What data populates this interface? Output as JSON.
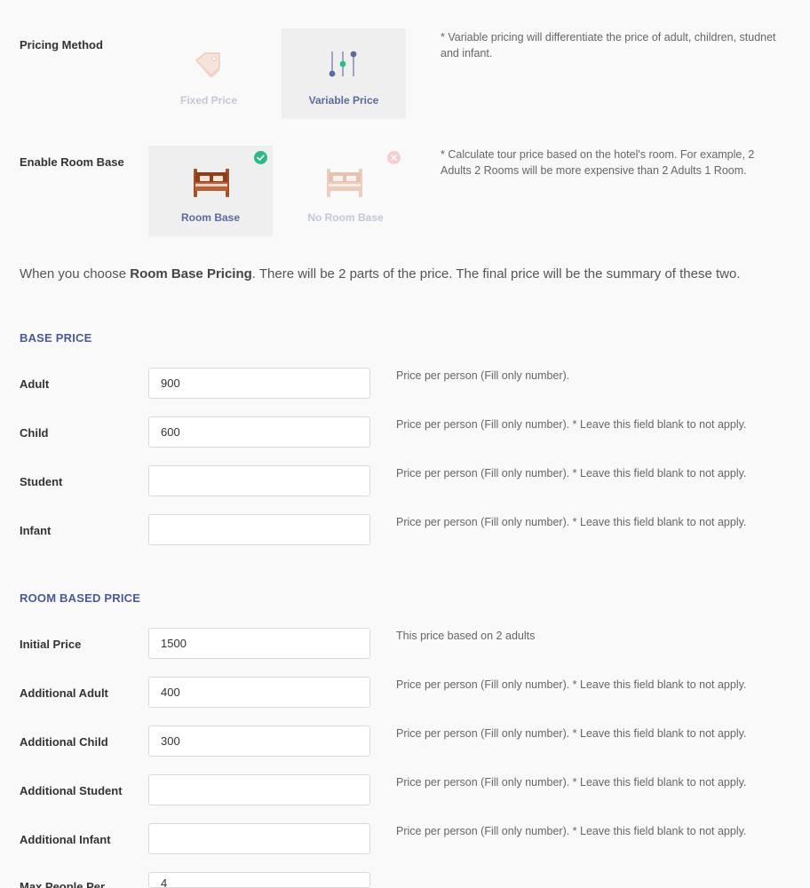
{
  "pricing_method": {
    "label": "Pricing Method",
    "options": [
      {
        "label": "Fixed Price",
        "selected": false
      },
      {
        "label": "Variable Price",
        "selected": true
      }
    ],
    "hint": "* Variable pricing will differentiate the price of adult, children, studnet and infant."
  },
  "room_base": {
    "label": "Enable Room Base",
    "options": [
      {
        "label": "Room Base",
        "selected": true
      },
      {
        "label": "No Room Base",
        "selected": false
      }
    ],
    "hint": "* Calculate tour price based on the hotel's room. For example, 2 Adults 2 Rooms will be more expensive than 2 Adults 1 Room."
  },
  "intro": {
    "prefix": "When you choose ",
    "bold": "Room Base Pricing",
    "suffix": ". There will be 2 parts of the price. The final price will be the summary of these two."
  },
  "base_price": {
    "title": "BASE PRICE",
    "rows": [
      {
        "label": "Adult",
        "value": "900",
        "hint": "Price per person (Fill only number)."
      },
      {
        "label": "Child",
        "value": "600",
        "hint": "Price per person (Fill only number). * Leave this field blank to not apply."
      },
      {
        "label": "Student",
        "value": "",
        "hint": "Price per person (Fill only number). * Leave this field blank to not apply."
      },
      {
        "label": "Infant",
        "value": "",
        "hint": "Price per person (Fill only number). * Leave this field blank to not apply."
      }
    ]
  },
  "room_price": {
    "title": "ROOM BASED PRICE",
    "rows": [
      {
        "label": "Initial Price",
        "value": "1500",
        "hint": "This price based on 2 adults"
      },
      {
        "label": "Additional Adult",
        "value": "400",
        "hint": "Price per person (Fill only number). * Leave this field blank to not apply."
      },
      {
        "label": "Additional Child",
        "value": "300",
        "hint": "Price per person (Fill only number). * Leave this field blank to not apply."
      },
      {
        "label": "Additional Student",
        "value": "",
        "hint": "Price per person (Fill only number). * Leave this field blank to not apply."
      },
      {
        "label": "Additional Infant",
        "value": "",
        "hint": "Price per person (Fill only number). * Leave this field blank to not apply."
      },
      {
        "label": "Max People Per",
        "value": "4",
        "hint": ""
      }
    ]
  },
  "colors": {
    "accent": "#4a5a96",
    "check_ok": "#2fb888",
    "check_no": "#f5cfcf",
    "bed_active": "#a0522d",
    "bed_inactive": "#e8c4b4"
  }
}
